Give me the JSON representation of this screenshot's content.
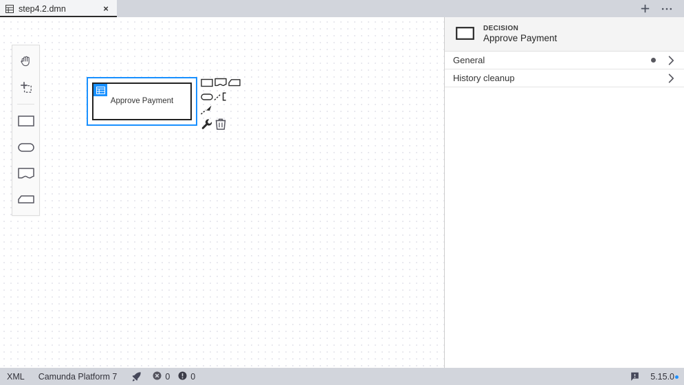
{
  "tab": {
    "title": "step4.2.dmn",
    "file_icon": "table-file-icon",
    "close_label": "×"
  },
  "tabbar_actions": {
    "add_label": "+",
    "more_label": "···"
  },
  "palette": {
    "tools": [
      {
        "name": "hand-tool",
        "title": "Activate hand tool"
      },
      {
        "name": "lasso-tool",
        "title": "Activate lasso tool"
      }
    ],
    "elements": [
      {
        "name": "create-decision",
        "title": "Create decision"
      },
      {
        "name": "create-input-data",
        "title": "Create input data"
      },
      {
        "name": "create-knowledge-source",
        "title": "Create knowledge source"
      },
      {
        "name": "create-business-knowledge-model",
        "title": "Create business knowledge model"
      }
    ]
  },
  "canvas": {
    "decision": {
      "label": "Approve Payment",
      "selected": true,
      "selection_color": "#1890ff",
      "icon_color": "#1890ff"
    },
    "context_pad": [
      {
        "name": "append-decision",
        "title": "Append decision"
      },
      {
        "name": "append-knowledge-source",
        "title": "Append knowledge source"
      },
      {
        "name": "append-business-knowledge-model",
        "title": "Append business knowledge model"
      },
      {
        "name": "append-input-data",
        "title": "Append input data"
      },
      {
        "name": "append-text-annotation",
        "title": "Append text annotation"
      },
      {
        "name": "connect",
        "title": "Connect"
      },
      {
        "name": "replace",
        "title": "Change type"
      },
      {
        "name": "delete",
        "title": "Remove"
      }
    ],
    "drawer_handle_title": "Open drawer"
  },
  "properties": {
    "element_type": "DECISION",
    "element_name": "Approve Payment",
    "groups": [
      {
        "label": "General",
        "has_dot": true
      },
      {
        "label": "History cleanup",
        "has_dot": false
      }
    ]
  },
  "statusbar": {
    "xml_label": "XML",
    "engine_label": "Camunda Platform 7",
    "deploy_title": "Deploy current diagram",
    "error_count": "0",
    "warning_count": "0",
    "notifications_title": "Notifications",
    "version": "5.15.0",
    "version_dot_color": "#1e90ff"
  }
}
